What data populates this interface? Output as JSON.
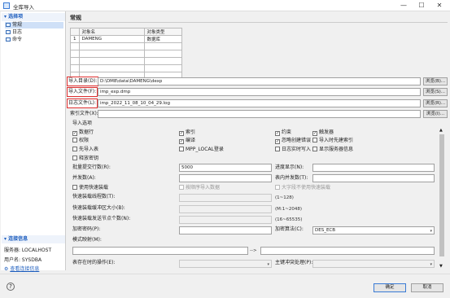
{
  "window": {
    "title": "全库导入",
    "minimize": "—",
    "maximize": "☐",
    "close": "✕"
  },
  "sidebar": {
    "select_header": "▾ 选择项",
    "items": [
      {
        "label": "常规"
      },
      {
        "label": "日志"
      },
      {
        "label": "命令"
      }
    ],
    "conn_header": "▾ 连接信息",
    "server": "服务器: LOCALHOST",
    "user": "用户名: SYSDBA",
    "view_conn": "查看连接信息"
  },
  "main": {
    "title": "常规",
    "table": {
      "headers": [
        "",
        "对象名",
        "对象类型"
      ],
      "rows": [
        [
          "1",
          "DAMENG",
          "数据库"
        ],
        [
          "",
          "",
          ""
        ],
        [
          "",
          "",
          ""
        ],
        [
          "",
          "",
          ""
        ],
        [
          "",
          "",
          ""
        ],
        [
          "",
          "",
          ""
        ]
      ]
    },
    "import_dir": {
      "label": "导入目录(D):",
      "value": "D:\\DM8\\data\\DAMENG\\dexp",
      "button": "浏览(B)..."
    },
    "import_file": {
      "label": "导入文件(F):",
      "value": "imp_exp.dmp",
      "button": "浏览(S)..."
    },
    "log_file": {
      "label": "日志文件(L):",
      "value": "imp_2022_11_08_10_04_29.log",
      "button": "浏览(R)..."
    },
    "index_file": {
      "label": "索引文件(X):",
      "value": "",
      "button": "浏览(I)..."
    },
    "options_title": "导入选项",
    "checks": [
      {
        "label": "数据行",
        "checked": true,
        "enabled": true
      },
      {
        "label": "索引",
        "checked": true,
        "enabled": true
      },
      {
        "label": "约束",
        "checked": true,
        "enabled": true
      },
      {
        "label": "触发器",
        "checked": true,
        "enabled": true
      },
      {
        "label": "权限",
        "checked": false,
        "enabled": true
      },
      {
        "label": "编译",
        "checked": true,
        "enabled": true
      },
      {
        "label": "忽略创建错误",
        "checked": true,
        "enabled": true
      },
      {
        "label": "导入时先建索引",
        "checked": false,
        "enabled": true
      },
      {
        "label": "先导入表",
        "checked": false,
        "enabled": true
      },
      {
        "label": "MPP_LOCAL登录",
        "checked": false,
        "enabled": true
      },
      {
        "label": "日志实时写入",
        "checked": false,
        "enabled": true
      },
      {
        "label": "显示服务器信息",
        "checked": false,
        "enabled": true
      },
      {
        "label": "释放密钥",
        "checked": false,
        "enabled": true
      }
    ],
    "batch_rows": {
      "label": "批量提交行数(R):",
      "value": "5000"
    },
    "progress": {
      "label": "进度显示(N):",
      "value": ""
    },
    "parallel": {
      "label": "并发数(A):",
      "value": ""
    },
    "table_parallel": {
      "label": "表内并发数(T):",
      "value": ""
    },
    "fast_load": {
      "label": "使用快速装载",
      "checked": false
    },
    "fast_load_by_data": {
      "label": "按顺序导入数据",
      "checked": false
    },
    "fast_load_big": {
      "label": "大字段不使用快速装载",
      "checked": false
    },
    "fast_threads": {
      "label": "快速装载线程数(T):",
      "range": "(1~128)"
    },
    "fast_buffer": {
      "label": "快速装载缓冲区大小(B):",
      "range": "(M:1~2048)"
    },
    "fast_nodes": {
      "label": "快速装载发送节点个数(N):",
      "range": "(16~65535)"
    },
    "encrypt_pwd": {
      "label": "加密密码(P):",
      "value": ""
    },
    "encrypt_alg": {
      "label": "加密算法(C):",
      "value": "DES_ECB"
    },
    "schema_map": {
      "label": "模式映射(M):",
      "arrow": "-->"
    },
    "table_exists": {
      "label": "表存在时的操作(E):",
      "value": ""
    },
    "pk_conflict": {
      "label": "主键冲突处理(P):",
      "value": ""
    }
  },
  "footer": {
    "ok": "确定",
    "cancel": "取消",
    "help": "?"
  }
}
